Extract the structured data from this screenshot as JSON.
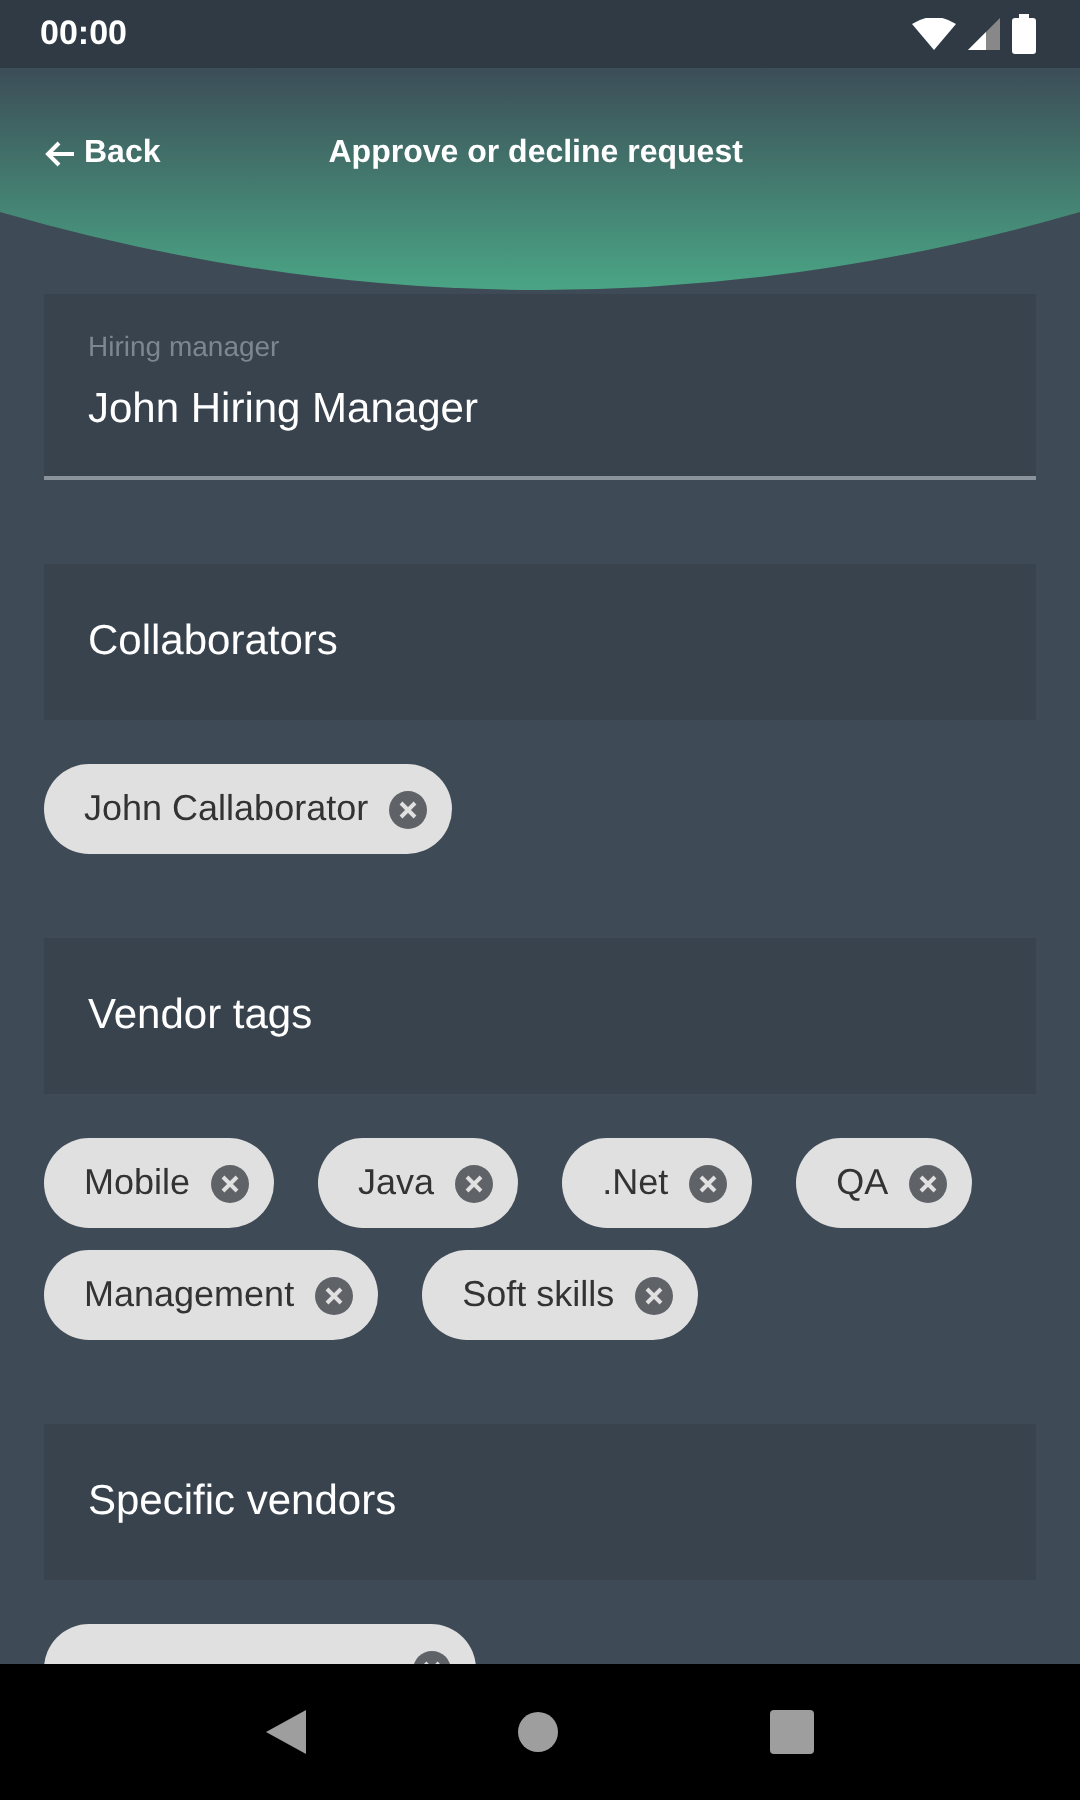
{
  "status_bar": {
    "time": "00:00"
  },
  "header": {
    "back": "Back",
    "title": "Approve or decline request"
  },
  "hiring_manager": {
    "label": "Hiring manager",
    "value": "John Hiring Manager"
  },
  "sections": [
    {
      "title": "Collaborators",
      "chips": [
        {
          "label": "John Callaborator",
          "removable": true
        }
      ]
    },
    {
      "title": "Vendor tags",
      "chips": [
        {
          "label": "Mobile",
          "removable": true
        },
        {
          "label": "Java",
          "removable": true
        },
        {
          "label": ".Net",
          "removable": true
        },
        {
          "label": "QA",
          "removable": true
        },
        {
          "label": "Management",
          "removable": true
        },
        {
          "label": "Soft skills",
          "removable": true
        }
      ]
    },
    {
      "title": "Specific vendors",
      "chips": [
        {
          "removable": true
        }
      ]
    }
  ]
}
